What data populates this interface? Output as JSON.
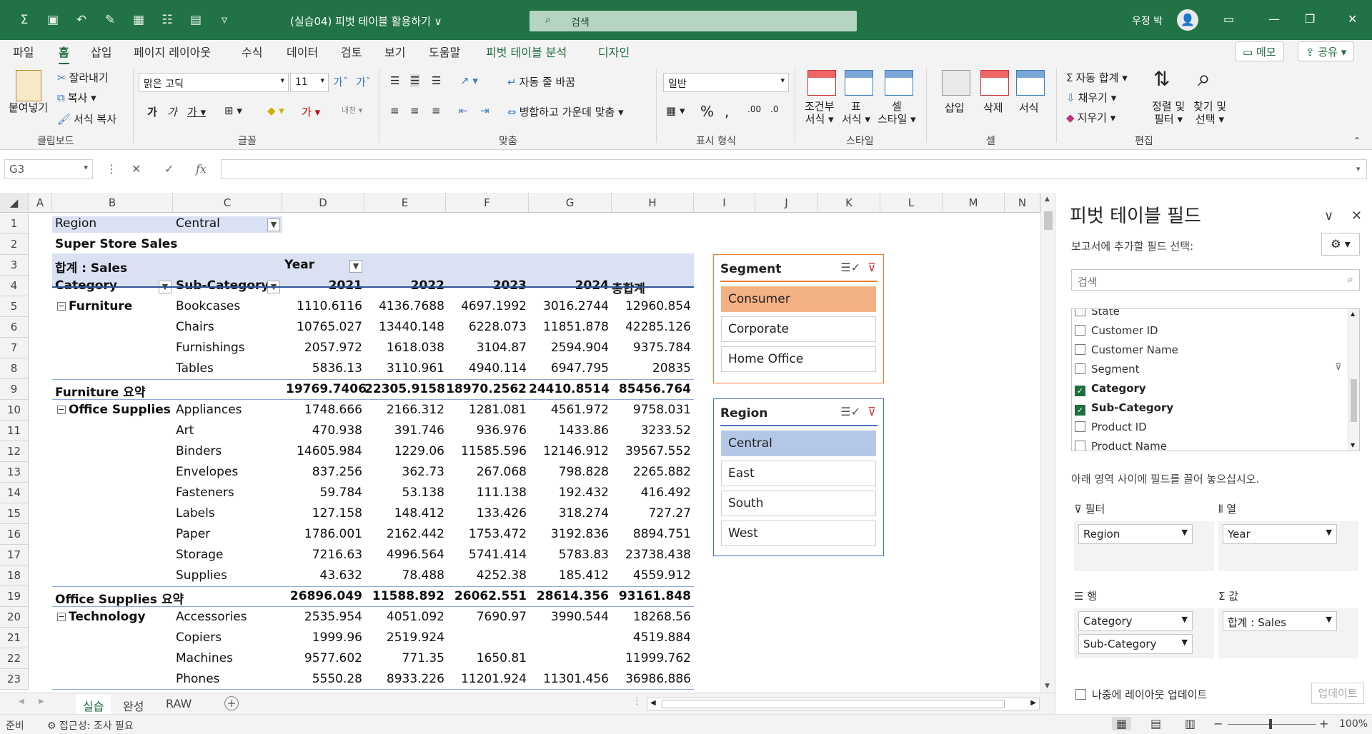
{
  "app": {
    "doc_title": "(실습04) 피벗 테이블 활용하기 ∨",
    "search_placeholder": "검색",
    "user_name": "우정 박"
  },
  "ribbon_tabs": [
    "파일",
    "홈",
    "삽입",
    "페이지 레이아웃",
    "수식",
    "데이터",
    "검토",
    "보기",
    "도움말",
    "피벗 테이블 분석",
    "디자인"
  ],
  "ribbon_buttons": {
    "note": "메모",
    "share": "공유",
    "paste": "붙여넣기",
    "cut": "잘라내기",
    "copy": "복사",
    "format_painter": "서식 복사",
    "font_name": "맑은 고딕",
    "font_size": "11",
    "wrap_text": "자동 줄 바꿈",
    "merge_center": "병합하고 가운데 맞춤",
    "number_format": "일반",
    "cond_format": "조건부 서식",
    "format_table": "표 서식",
    "cell_style": "셀 스타일",
    "insert": "삽입",
    "delete": "삭제",
    "format": "서식",
    "autosum": "자동 합계",
    "fill": "채우기",
    "clear": "지우기",
    "sort_filter": "정렬 및 필터",
    "find_select": "찾기 및 선택"
  },
  "ribbon_groups": [
    "클립보드",
    "글꼴",
    "맞춤",
    "표시 형식",
    "스타일",
    "셀",
    "편집"
  ],
  "formula_bar": {
    "name_box": "G3",
    "fx": "fx"
  },
  "columns": [
    "A",
    "B",
    "C",
    "D",
    "E",
    "F",
    "G",
    "H",
    "I",
    "J",
    "K",
    "L",
    "M",
    "N"
  ],
  "rows": [
    "1",
    "2",
    "3",
    "4",
    "5",
    "6",
    "7",
    "8",
    "9",
    "10",
    "11",
    "12",
    "13",
    "14",
    "15",
    "16",
    "17",
    "18",
    "19",
    "20",
    "21",
    "22",
    "23"
  ],
  "pivot": {
    "filter_label": "Region",
    "filter_value": "Central",
    "title": "Super Store Sales",
    "values_label": "합계 : Sales",
    "col_field": "Year",
    "row_field1": "Category",
    "row_field2": "Sub-Category",
    "years": [
      "2021",
      "2022",
      "2023",
      "2024"
    ],
    "grand_total_label": "총합계",
    "rows": [
      {
        "cat": "Furniture",
        "sub": "Bookcases",
        "v": [
          "1110.6116",
          "4136.7688",
          "4697.1992",
          "3016.2744",
          "12960.854"
        ]
      },
      {
        "cat": "",
        "sub": "Chairs",
        "v": [
          "10765.027",
          "13440.148",
          "6228.073",
          "11851.878",
          "42285.126"
        ]
      },
      {
        "cat": "",
        "sub": "Furnishings",
        "v": [
          "2057.972",
          "1618.038",
          "3104.87",
          "2594.904",
          "9375.784"
        ]
      },
      {
        "cat": "",
        "sub": "Tables",
        "v": [
          "5836.13",
          "3110.961",
          "4940.114",
          "6947.795",
          "20835"
        ]
      },
      {
        "total": "Furniture 요약",
        "v": [
          "19769.7406",
          "22305.9158",
          "18970.2562",
          "24410.8514",
          "85456.764"
        ]
      },
      {
        "cat": "Office Supplies",
        "sub": "Appliances",
        "v": [
          "1748.666",
          "2166.312",
          "1281.081",
          "4561.972",
          "9758.031"
        ]
      },
      {
        "cat": "",
        "sub": "Art",
        "v": [
          "470.938",
          "391.746",
          "936.976",
          "1433.86",
          "3233.52"
        ]
      },
      {
        "cat": "",
        "sub": "Binders",
        "v": [
          "14605.984",
          "1229.06",
          "11585.596",
          "12146.912",
          "39567.552"
        ]
      },
      {
        "cat": "",
        "sub": "Envelopes",
        "v": [
          "837.256",
          "362.73",
          "267.068",
          "798.828",
          "2265.882"
        ]
      },
      {
        "cat": "",
        "sub": "Fasteners",
        "v": [
          "59.784",
          "53.138",
          "111.138",
          "192.432",
          "416.492"
        ]
      },
      {
        "cat": "",
        "sub": "Labels",
        "v": [
          "127.158",
          "148.412",
          "133.426",
          "318.274",
          "727.27"
        ]
      },
      {
        "cat": "",
        "sub": "Paper",
        "v": [
          "1786.001",
          "2162.442",
          "1753.472",
          "3192.836",
          "8894.751"
        ]
      },
      {
        "cat": "",
        "sub": "Storage",
        "v": [
          "7216.63",
          "4996.564",
          "5741.414",
          "5783.83",
          "23738.438"
        ]
      },
      {
        "cat": "",
        "sub": "Supplies",
        "v": [
          "43.632",
          "78.488",
          "4252.38",
          "185.412",
          "4559.912"
        ]
      },
      {
        "total": "Office Supplies 요약",
        "v": [
          "26896.049",
          "11588.892",
          "26062.551",
          "28614.356",
          "93161.848"
        ]
      },
      {
        "cat": "Technology",
        "sub": "Accessories",
        "v": [
          "2535.954",
          "4051.092",
          "7690.97",
          "3990.544",
          "18268.56"
        ]
      },
      {
        "cat": "",
        "sub": "Copiers",
        "v": [
          "1999.96",
          "2519.924",
          "",
          "",
          "4519.884"
        ]
      },
      {
        "cat": "",
        "sub": "Machines",
        "v": [
          "9577.602",
          "771.35",
          "1650.81",
          "",
          "11999.762"
        ]
      },
      {
        "cat": "",
        "sub": "Phones",
        "v": [
          "5550.28",
          "8933.226",
          "11201.924",
          "11301.456",
          "36986.886"
        ]
      }
    ]
  },
  "slicers": {
    "segment": {
      "title": "Segment",
      "items": [
        "Consumer",
        "Corporate",
        "Home Office"
      ],
      "selected": "Consumer",
      "accent": "#f4b183"
    },
    "region": {
      "title": "Region",
      "items": [
        "Central",
        "East",
        "South",
        "West"
      ],
      "selected": "Central",
      "accent": "#b4c7e7"
    }
  },
  "sheet_tabs": [
    "실습",
    "완성",
    "RAW"
  ],
  "status": {
    "ready": "준비",
    "accessibility": "접근성: 조사 필요",
    "zoom": "100%"
  },
  "pane": {
    "title": "피벗 테이블 필드",
    "subtitle": "보고서에 추가할 필드 선택:",
    "search_placeholder": "검색",
    "fields": [
      {
        "name": "State",
        "checked": false
      },
      {
        "name": "Customer ID",
        "checked": false
      },
      {
        "name": "Customer Name",
        "checked": false
      },
      {
        "name": "Segment",
        "checked": false
      },
      {
        "name": "Category",
        "checked": true
      },
      {
        "name": "Sub-Category",
        "checked": true
      },
      {
        "name": "Product ID",
        "checked": false
      },
      {
        "name": "Product Name",
        "checked": false
      }
    ],
    "drag_hint": "아래 영역 사이에 필드를 끌어 놓으십시오.",
    "areas": {
      "filter": {
        "label": "필터",
        "items": [
          "Region"
        ]
      },
      "columns": {
        "label": "열",
        "items": [
          "Year"
        ]
      },
      "rows": {
        "label": "행",
        "items": [
          "Category",
          "Sub-Category"
        ]
      },
      "values": {
        "label": "값",
        "items": [
          "합계 : Sales"
        ]
      }
    },
    "defer_label": "나중에 레이아웃 업데이트",
    "update_label": "업데이트"
  },
  "colors": {
    "excel_green": "#217346",
    "pivot_header": "#d9e1f2",
    "segment_border": "#ed7d31",
    "region_border": "#4472c4"
  }
}
